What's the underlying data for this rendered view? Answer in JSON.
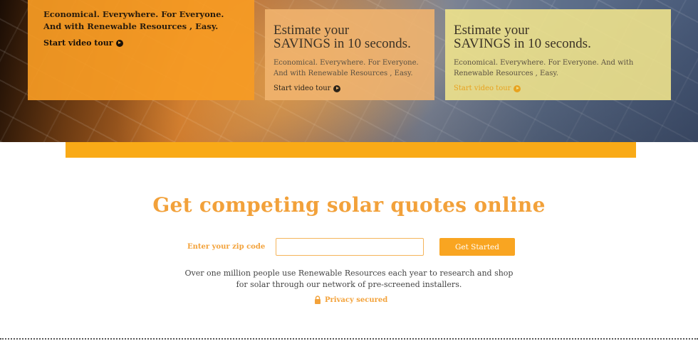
{
  "hero": {
    "card1": {
      "tagline": "Economical. Everywhere. For Everyone. And with Renewable Resources , Easy.",
      "tour_label": "Start video tour"
    },
    "card2": {
      "title_line1": "Estimate your",
      "title_line2": "SAVINGS in 10 seconds.",
      "desc": "Economical. Everywhere. For Everyone. And with Renewable Resources , Easy.",
      "tour_label": "Start video tour"
    },
    "card3": {
      "title_line1": "Estimate your",
      "title_line2": "SAVINGS in 10 seconds.",
      "desc": "Economical. Everywhere. For Everyone. And with Renewable Resources , Easy.",
      "tour_label": "Start video tour"
    }
  },
  "quote": {
    "headline": "Get competing solar quotes online",
    "zip_label": "Enter your zip code",
    "zip_value": "",
    "zip_placeholder": "",
    "button_label": "Get Started",
    "blurb": "Over one million people use Renewable Resources each year to research and shop for solar through our network of pre-screened installers.",
    "privacy_label": "Privacy secured"
  },
  "colors": {
    "accent": "#f9aa17",
    "headline": "#f2a13a",
    "card1_bg": "#f69b23",
    "card2_bg": "#f1b46e",
    "card3_bg": "#eee28c"
  },
  "icons": {
    "tour": "play-circle-icon",
    "privacy": "lock-icon"
  }
}
